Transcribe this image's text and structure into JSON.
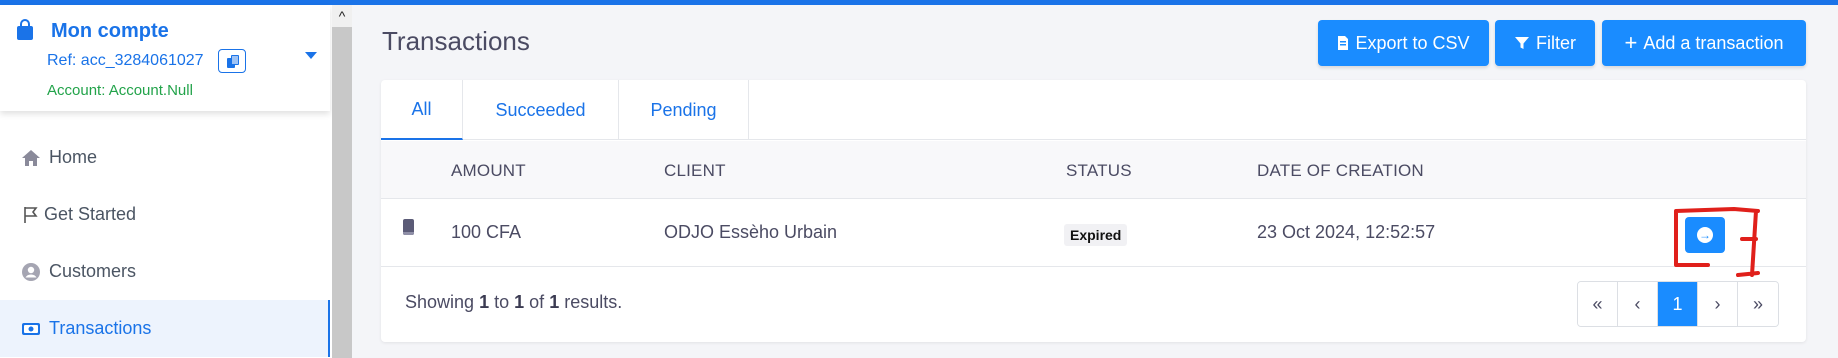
{
  "account": {
    "title": "Mon compte",
    "ref": "Ref: acc_3284061027",
    "status": "Account: Account.Null"
  },
  "sidebar": {
    "items": [
      {
        "label": "Home",
        "icon": "home-icon"
      },
      {
        "label": "Get Started",
        "icon": "flag-icon"
      },
      {
        "label": "Customers",
        "icon": "user-icon"
      },
      {
        "label": "Transactions",
        "icon": "money-icon",
        "active": true
      }
    ]
  },
  "header": {
    "title": "Transactions",
    "export_label": "Export to CSV",
    "filter_label": "Filter",
    "add_label": "Add a transaction"
  },
  "tabs": [
    {
      "label": "All",
      "active": true
    },
    {
      "label": "Succeeded"
    },
    {
      "label": "Pending"
    }
  ],
  "table": {
    "columns": [
      "AMOUNT",
      "CLIENT",
      "STATUS",
      "DATE OF CREATION"
    ],
    "rows": [
      {
        "amount": "100 CFA",
        "client": "ODJO Essèho Urbain",
        "status": "Expired",
        "date": "23 Oct 2024, 12:52:57"
      }
    ]
  },
  "footer": {
    "showing": "Showing",
    "from": "1",
    "to_word": "to",
    "to": "1",
    "of_word": "of",
    "total": "1",
    "results": "results."
  },
  "pagination": {
    "first": "«",
    "prev": "‹",
    "current": "1",
    "next": "›",
    "last": "»"
  },
  "colors": {
    "accent": "#1a73e8",
    "button": "#1a8cff",
    "success": "#22a34a",
    "annotation": "#e0201b"
  }
}
